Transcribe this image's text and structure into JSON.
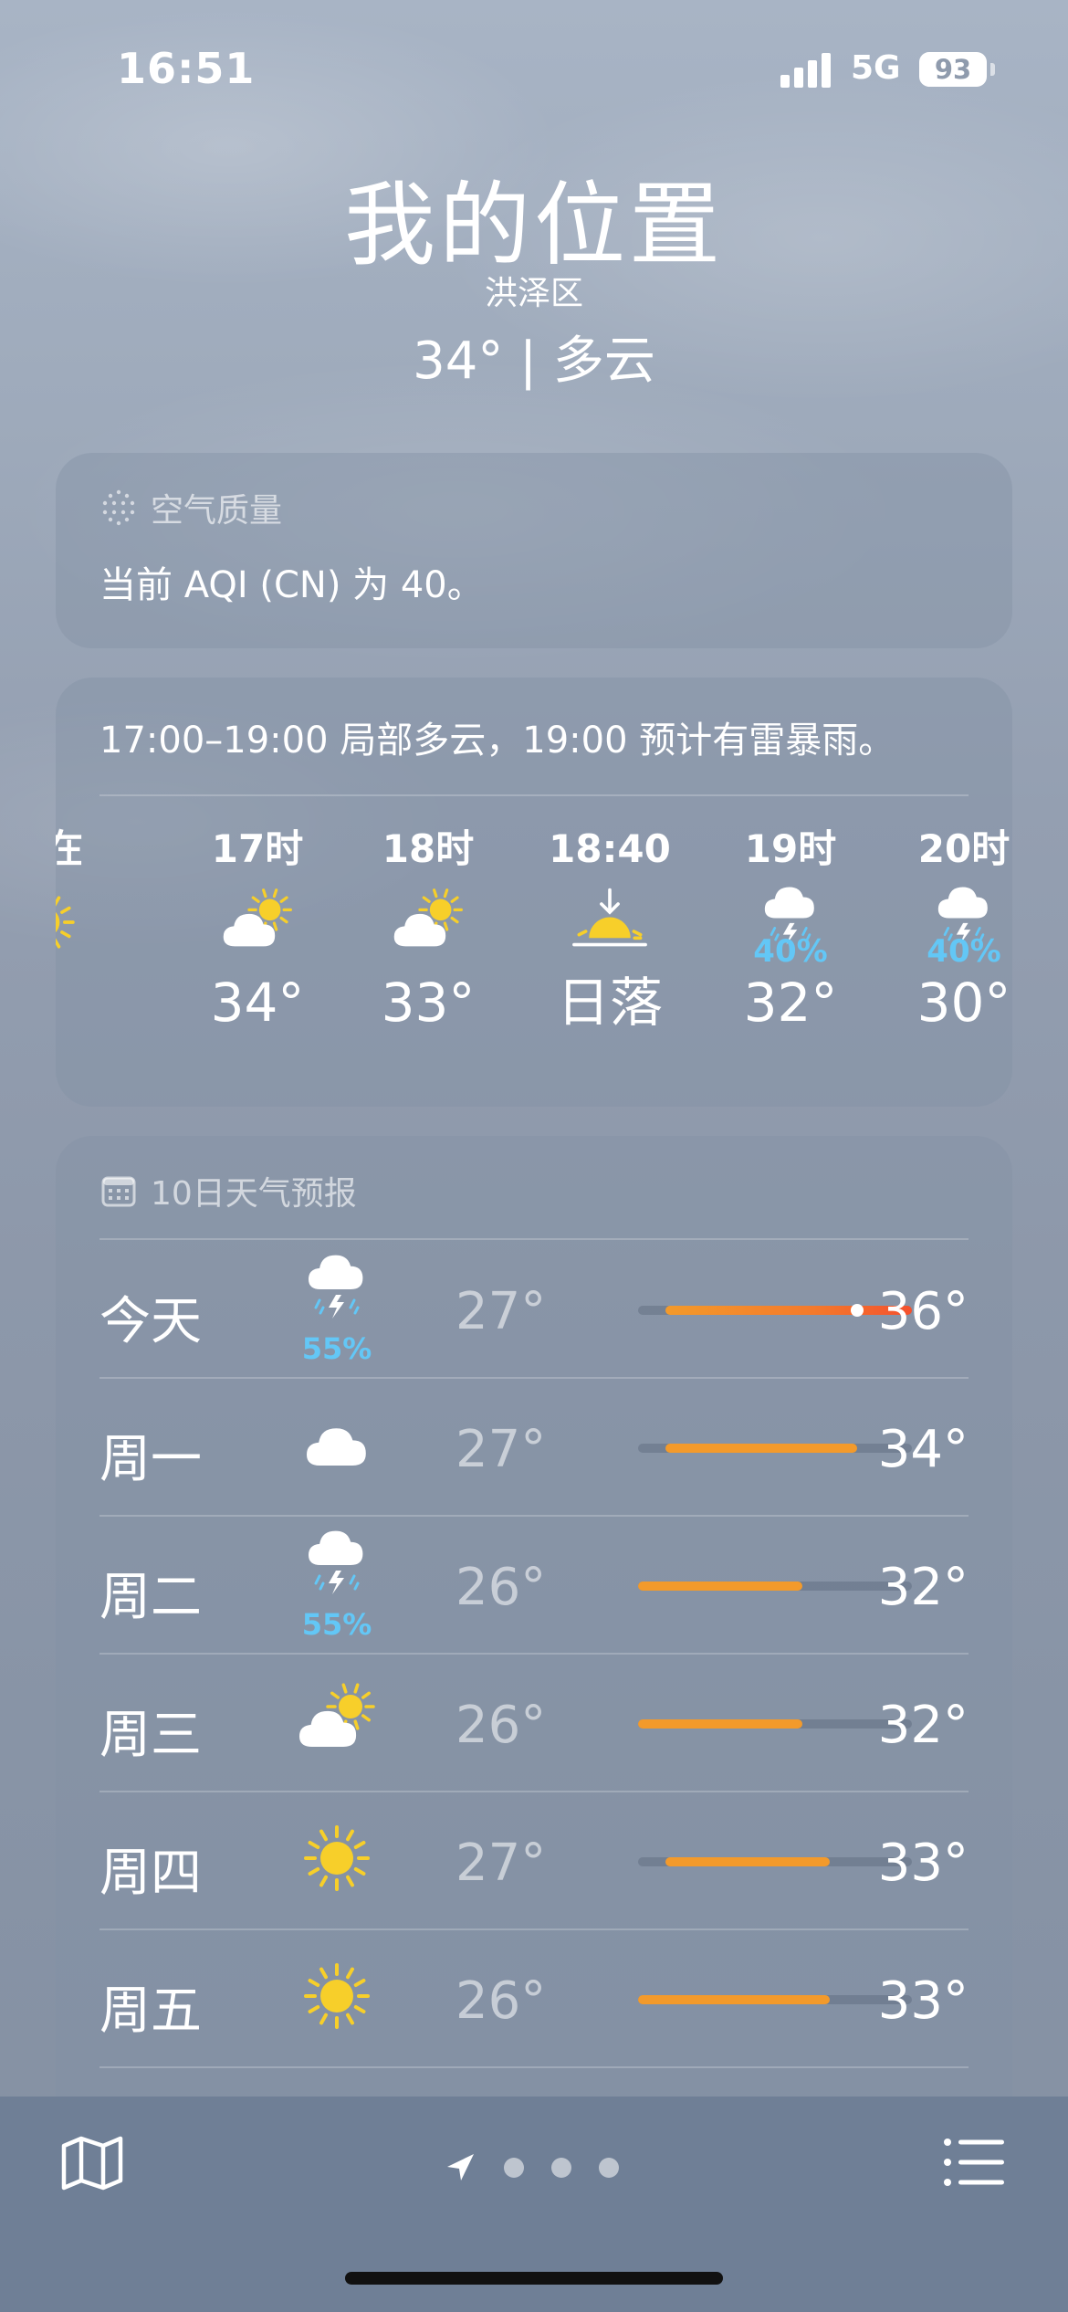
{
  "status_bar": {
    "time": "16:51",
    "network": "5G",
    "battery": "93"
  },
  "header": {
    "title": "我的位置",
    "district": "洪泽区",
    "summary": "34° | 多云"
  },
  "air_quality": {
    "heading": "空气质量",
    "text": "当前 AQI (CN) 为 40。",
    "icon": "aqi-dots-icon"
  },
  "hourly": {
    "summary": "17:00–19:00 局部多云，19:00 预计有雷暴雨。",
    "items": [
      {
        "label": "现在",
        "icon": "sun-icon",
        "temp": "°",
        "pop": ""
      },
      {
        "label": "17时",
        "icon": "partly-cloudy-icon",
        "temp": "34°",
        "pop": ""
      },
      {
        "label": "18时",
        "icon": "partly-cloudy-icon",
        "temp": "33°",
        "pop": ""
      },
      {
        "label": "18:40",
        "icon": "sunset-icon",
        "temp": "日落",
        "pop": ""
      },
      {
        "label": "19时",
        "icon": "thunderstorm-icon",
        "temp": "32°",
        "pop": "40%"
      },
      {
        "label": "20时",
        "icon": "thunderstorm-icon",
        "temp": "30°",
        "pop": "40%"
      }
    ]
  },
  "daily": {
    "heading": "10日天气预报",
    "icon": "calendar-icon",
    "range": [
      26,
      36
    ],
    "days": [
      {
        "name": "今天",
        "icon": "thunderstorm-icon",
        "pop": "55%",
        "low": "27°",
        "high": "36°",
        "low_value": 27,
        "high_value": 36,
        "current_value": 34
      },
      {
        "name": "周一",
        "icon": "cloud-icon",
        "pop": "",
        "low": "27°",
        "high": "34°",
        "low_value": 27,
        "high_value": 34
      },
      {
        "name": "周二",
        "icon": "thunderstorm-icon",
        "pop": "55%",
        "low": "26°",
        "high": "32°",
        "low_value": 26,
        "high_value": 32
      },
      {
        "name": "周三",
        "icon": "partly-cloudy-icon",
        "pop": "",
        "low": "26°",
        "high": "32°",
        "low_value": 26,
        "high_value": 32
      },
      {
        "name": "周四",
        "icon": "sun-icon",
        "pop": "",
        "low": "27°",
        "high": "33°",
        "low_value": 27,
        "high_value": 33
      },
      {
        "name": "周五",
        "icon": "sun-icon",
        "pop": "",
        "low": "26°",
        "high": "33°",
        "low_value": 26,
        "high_value": 33
      }
    ]
  },
  "toolbar": {
    "map_icon": "map-icon",
    "location_icon": "location-arrow-icon",
    "list_icon": "list-icon",
    "page_count": 3
  },
  "colors": {
    "pop_blue": "#63c7f6",
    "bar_orange": "#f39a2b",
    "bar_red": "#f4512e",
    "sun_yellow": "#f7cf2a"
  }
}
